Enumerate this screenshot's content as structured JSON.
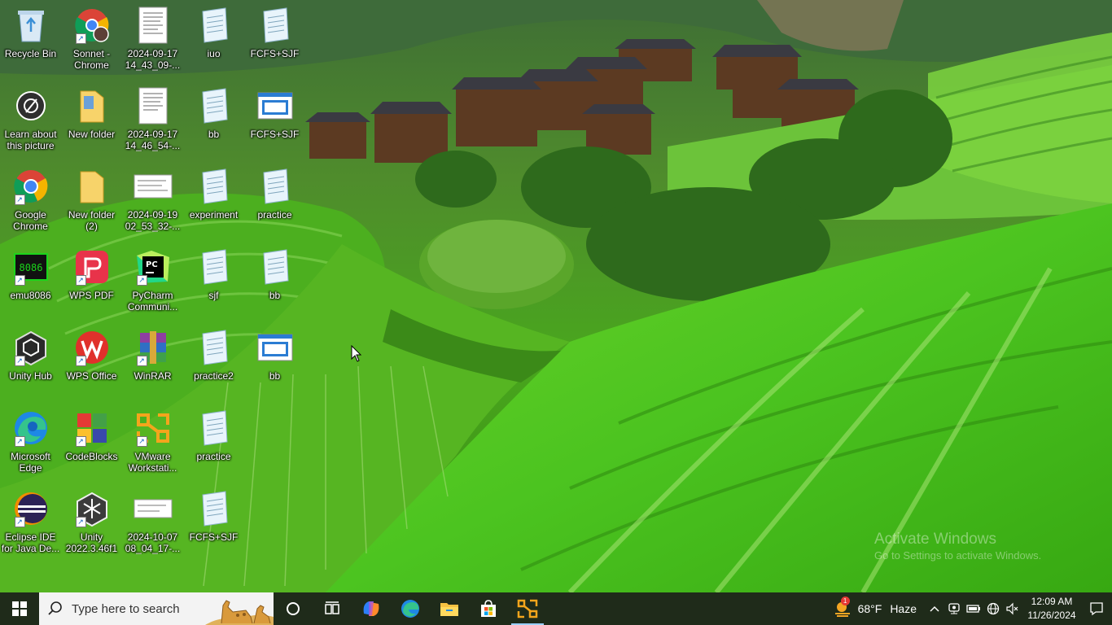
{
  "desktop": {
    "icons": [
      {
        "label": "Recycle Bin",
        "icon": "recycle-bin-icon",
        "shortcut": false
      },
      {
        "label": "Learn about this picture",
        "icon": "learn-about-picture-icon",
        "shortcut": false
      },
      {
        "label": "Google Chrome",
        "icon": "chrome-icon",
        "shortcut": true
      },
      {
        "label": "emu8086",
        "icon": "emu8086-icon",
        "shortcut": true
      },
      {
        "label": "Unity Hub",
        "icon": "unity-hub-icon",
        "shortcut": true
      },
      {
        "label": "Microsoft Edge",
        "icon": "edge-icon",
        "shortcut": true
      },
      {
        "label": "Eclipse IDE for Java De...",
        "icon": "eclipse-icon",
        "shortcut": true
      },
      {
        "label": "Sonnet - Chrome",
        "icon": "chrome-profile-icon",
        "shortcut": true
      },
      {
        "label": "New folder",
        "icon": "folder-icon",
        "shortcut": false
      },
      {
        "label": "New folder (2)",
        "icon": "folder-icon",
        "shortcut": false
      },
      {
        "label": "WPS PDF",
        "icon": "wps-pdf-icon",
        "shortcut": true
      },
      {
        "label": "WPS Office",
        "icon": "wps-office-icon",
        "shortcut": true
      },
      {
        "label": "CodeBlocks",
        "icon": "codeblocks-icon",
        "shortcut": true
      },
      {
        "label": "Unity 2022.3.46f1",
        "icon": "unity-icon",
        "shortcut": true
      },
      {
        "label": "2024-09-17 14_43_09-...",
        "icon": "document-thumbnail-icon",
        "shortcut": false
      },
      {
        "label": "2024-09-17 14_46_54-...",
        "icon": "document-thumbnail-icon",
        "shortcut": false
      },
      {
        "label": "2024-09-19 02_53_32-...",
        "icon": "screenshot-thumbnail-icon",
        "shortcut": false
      },
      {
        "label": "PyCharm Communi...",
        "icon": "pycharm-icon",
        "shortcut": true
      },
      {
        "label": "WinRAR",
        "icon": "winrar-icon",
        "shortcut": true
      },
      {
        "label": "VMware Workstati...",
        "icon": "vmware-icon",
        "shortcut": true
      },
      {
        "label": "2024-10-07 08_04_17-...",
        "icon": "screenshot-thumbnail-icon",
        "shortcut": false
      },
      {
        "label": "iuo",
        "icon": "text-file-icon",
        "shortcut": false
      },
      {
        "label": "bb",
        "icon": "text-file-icon",
        "shortcut": false
      },
      {
        "label": "experiment",
        "icon": "text-file-icon",
        "shortcut": false
      },
      {
        "label": "sjf",
        "icon": "text-file-icon",
        "shortcut": false
      },
      {
        "label": "practice2",
        "icon": "text-file-icon",
        "shortcut": false
      },
      {
        "label": "practice",
        "icon": "text-file-icon",
        "shortcut": false
      },
      {
        "label": "FCFS+SJF",
        "icon": "text-file-icon",
        "shortcut": false
      },
      {
        "label": "FCFS+SJF",
        "icon": "text-file-icon",
        "shortcut": false
      },
      {
        "label": "FCFS+SJF",
        "icon": "word-doc-icon",
        "shortcut": false
      },
      {
        "label": "practice",
        "icon": "text-file-icon",
        "shortcut": false
      },
      {
        "label": "bb",
        "icon": "text-file-icon",
        "shortcut": false
      },
      {
        "label": "bb",
        "icon": "word-doc-icon",
        "shortcut": false
      }
    ]
  },
  "watermark": {
    "title": "Activate Windows",
    "subtitle": "Go to Settings to activate Windows."
  },
  "taskbar": {
    "search_placeholder": "Type here to search",
    "pinned": [
      {
        "name": "cortana-icon"
      },
      {
        "name": "task-view-icon"
      },
      {
        "name": "copilot-icon"
      },
      {
        "name": "edge-taskbar-icon"
      },
      {
        "name": "file-explorer-icon"
      },
      {
        "name": "microsoft-store-icon"
      },
      {
        "name": "vmware-taskbar-icon"
      }
    ],
    "weather": {
      "temp": "68°F",
      "condition": "Haze",
      "badge": "1"
    },
    "clock": {
      "time": "12:09 AM",
      "date": "11/26/2024"
    }
  },
  "colors": {
    "taskbar_bg": "#1f2b1a",
    "search_bg": "#f3f3f3"
  }
}
